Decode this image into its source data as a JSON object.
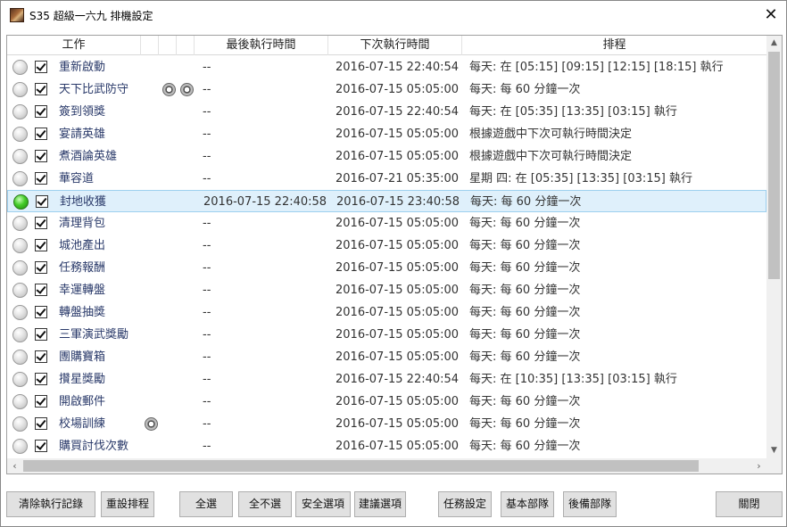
{
  "window": {
    "title": "S35 超級一六九 排機設定",
    "close_glyph": "✕"
  },
  "columns": {
    "task": "工作",
    "last_run": "最後執行時間",
    "next_run": "下次執行時間",
    "schedule": "排程"
  },
  "rows": [
    {
      "name": "重新啟動",
      "last": "--",
      "next": "2016-07-15 22:40:54",
      "sched": "每天: 在 [05:15] [09:15] [12:15] [18:15] 執行",
      "active": false,
      "icons": []
    },
    {
      "name": "天下比武防守",
      "last": "--",
      "next": "2016-07-15 05:05:00",
      "sched": "每天: 每 60 分鐘一次",
      "active": false,
      "icons": [
        "settings-icon",
        "settings-icon"
      ]
    },
    {
      "name": "簽到領獎",
      "last": "--",
      "next": "2016-07-15 22:40:54",
      "sched": "每天: 在 [05:35] [13:35] [03:15] 執行",
      "active": false,
      "icons": []
    },
    {
      "name": "宴請英雄",
      "last": "--",
      "next": "2016-07-15 05:05:00",
      "sched": "根據遊戲中下次可執行時間決定",
      "active": false,
      "icons": []
    },
    {
      "name": "煮酒論英雄",
      "last": "--",
      "next": "2016-07-15 05:05:00",
      "sched": "根據遊戲中下次可執行時間決定",
      "active": false,
      "icons": []
    },
    {
      "name": "華容道",
      "last": "--",
      "next": "2016-07-21 05:35:00",
      "sched": "星期 四: 在 [05:35] [13:35] [03:15] 執行",
      "active": false,
      "icons": []
    },
    {
      "name": "封地收獲",
      "last": "2016-07-15 22:40:58",
      "next": "2016-07-15 23:40:58",
      "sched": "每天: 每 60 分鐘一次",
      "active": true,
      "icons": []
    },
    {
      "name": "清理背包",
      "last": "--",
      "next": "2016-07-15 05:05:00",
      "sched": "每天: 每 60 分鐘一次",
      "active": false,
      "icons": []
    },
    {
      "name": "城池產出",
      "last": "--",
      "next": "2016-07-15 05:05:00",
      "sched": "每天: 每 60 分鐘一次",
      "active": false,
      "icons": []
    },
    {
      "name": "任務報酬",
      "last": "--",
      "next": "2016-07-15 05:05:00",
      "sched": "每天: 每 60 分鐘一次",
      "active": false,
      "icons": []
    },
    {
      "name": "幸運轉盤",
      "last": "--",
      "next": "2016-07-15 05:05:00",
      "sched": "每天: 每 60 分鐘一次",
      "active": false,
      "icons": []
    },
    {
      "name": "轉盤抽獎",
      "last": "--",
      "next": "2016-07-15 05:05:00",
      "sched": "每天: 每 60 分鐘一次",
      "active": false,
      "icons": []
    },
    {
      "name": "三軍演武獎勵",
      "last": "--",
      "next": "2016-07-15 05:05:00",
      "sched": "每天: 每 60 分鐘一次",
      "active": false,
      "icons": []
    },
    {
      "name": "團購寶箱",
      "last": "--",
      "next": "2016-07-15 05:05:00",
      "sched": "每天: 每 60 分鐘一次",
      "active": false,
      "icons": []
    },
    {
      "name": "攢星獎勵",
      "last": "--",
      "next": "2016-07-15 22:40:54",
      "sched": "每天: 在 [10:35] [13:35] [03:15] 執行",
      "active": false,
      "icons": []
    },
    {
      "name": "開啟郵件",
      "last": "--",
      "next": "2016-07-15 05:05:00",
      "sched": "每天: 每 60 分鐘一次",
      "active": false,
      "icons": []
    },
    {
      "name": "校場訓練",
      "last": "--",
      "next": "2016-07-15 05:05:00",
      "sched": "每天: 每 60 分鐘一次",
      "active": false,
      "icons": [
        "settings-icon"
      ]
    },
    {
      "name": "購買討伐次數",
      "last": "--",
      "next": "2016-07-15 05:05:00",
      "sched": "每天: 每 60 分鐘一次",
      "active": false,
      "icons": []
    }
  ],
  "buttons": {
    "clear_log": "清除執行記錄",
    "reset_schedule": "重設排程",
    "select_all": "全選",
    "select_none": "全不選",
    "safe_options": "安全選項",
    "recommended": "建議選項",
    "task_settings": "任務設定",
    "basic_troops": "基本部隊",
    "backup_troops": "後備部隊",
    "close": "關閉"
  },
  "scroll": {
    "up": "▲",
    "down": "▼",
    "left": "‹",
    "right": "›"
  },
  "colors": {
    "active_light": "#33bb22",
    "selected_row": "#dff0fb"
  }
}
